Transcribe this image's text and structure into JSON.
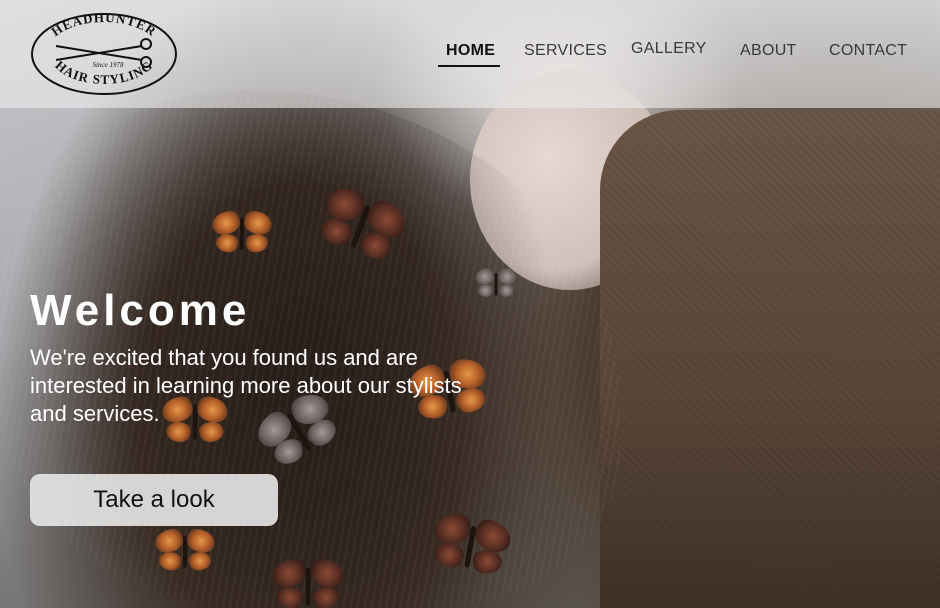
{
  "logo": {
    "top_text": "HEADHUNTER",
    "since_text": "Since 1978",
    "bottom_text": "HAIR STYLING"
  },
  "nav": {
    "items": [
      {
        "label": "HOME",
        "active": true
      },
      {
        "label": "SERVICES",
        "active": false
      },
      {
        "label": "GALLERY",
        "active": false
      },
      {
        "label": "ABOUT",
        "active": false
      },
      {
        "label": "CONTACT",
        "active": false
      }
    ]
  },
  "hero": {
    "title": "Welcome",
    "text": "We're excited that you found us and are interested in learning more about our stylists and services.",
    "button_label": "Take a look"
  },
  "colors": {
    "header_bg": "#ebebeb",
    "hero_text": "#ffffff",
    "button_bg": "#e4e4e4"
  }
}
